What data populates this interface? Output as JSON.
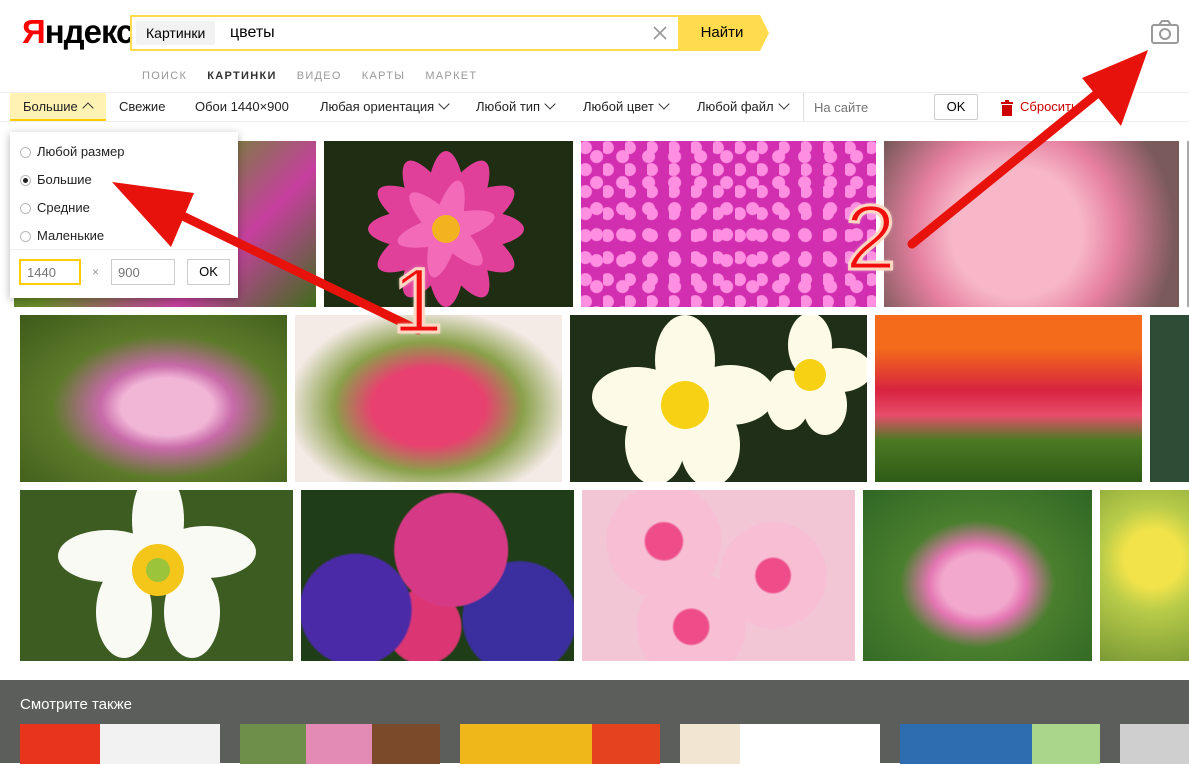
{
  "header": {
    "logo": "Яндекс",
    "logo_first": "Я",
    "logo_rest": "ндекс",
    "service_tag": "Картинки",
    "query": "цветы",
    "find_button": "Найти",
    "camera_icon": "camera-icon"
  },
  "tabs": [
    {
      "label": "ПОИСК",
      "active": false
    },
    {
      "label": "КАРТИНКИ",
      "active": true
    },
    {
      "label": "ВИДЕО",
      "active": false
    },
    {
      "label": "КАРТЫ",
      "active": false
    },
    {
      "label": "МАРКЕТ",
      "active": false
    }
  ],
  "filters": {
    "size": "Большие",
    "fresh": "Свежие",
    "wallpaper": "Обои 1440×900",
    "orientation": "Любая ориентация",
    "type": "Любой тип",
    "color": "Любой цвет",
    "file": "Любой файл",
    "site_placeholder": "На сайте",
    "ok": "OK",
    "reset": "Сбросить"
  },
  "size_dropdown": {
    "options": [
      {
        "label": "Любой размер",
        "selected": false
      },
      {
        "label": "Большие",
        "selected": true
      },
      {
        "label": "Средние",
        "selected": false
      },
      {
        "label": "Маленькие",
        "selected": false
      }
    ],
    "width_placeholder": "1440",
    "times": "×",
    "height_placeholder": "900",
    "ok": "OK"
  },
  "annotations": {
    "label_1": "1",
    "label_2": "2",
    "arrow_color": "#e8120c"
  },
  "see_also": {
    "title": "Смотрите также"
  },
  "colors": {
    "accent_yellow": "#ffdb4d",
    "brand_red": "#ff0000",
    "reset_red": "#cc0000",
    "footer_bg": "#5b5e5a"
  }
}
